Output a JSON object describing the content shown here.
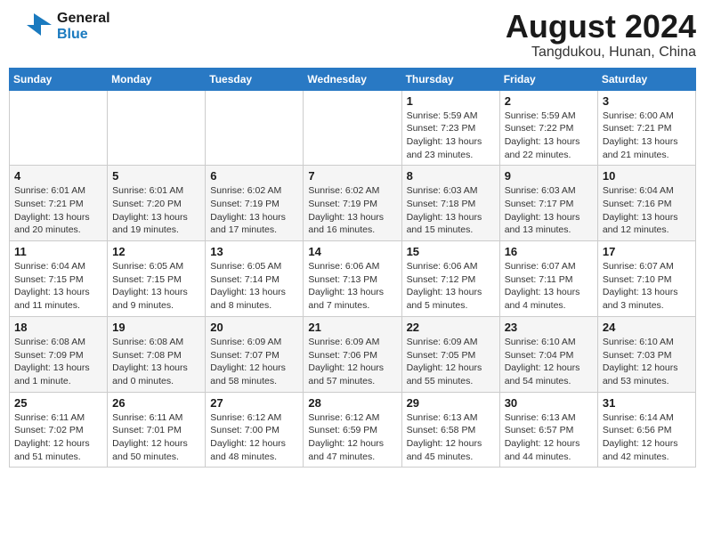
{
  "header": {
    "logo_line1": "General",
    "logo_line2": "Blue",
    "title": "August 2024",
    "subtitle": "Tangdukou, Hunan, China"
  },
  "weekdays": [
    "Sunday",
    "Monday",
    "Tuesday",
    "Wednesday",
    "Thursday",
    "Friday",
    "Saturday"
  ],
  "weeks": [
    [
      {
        "day": "",
        "info": ""
      },
      {
        "day": "",
        "info": ""
      },
      {
        "day": "",
        "info": ""
      },
      {
        "day": "",
        "info": ""
      },
      {
        "day": "1",
        "info": "Sunrise: 5:59 AM\nSunset: 7:23 PM\nDaylight: 13 hours\nand 23 minutes."
      },
      {
        "day": "2",
        "info": "Sunrise: 5:59 AM\nSunset: 7:22 PM\nDaylight: 13 hours\nand 22 minutes."
      },
      {
        "day": "3",
        "info": "Sunrise: 6:00 AM\nSunset: 7:21 PM\nDaylight: 13 hours\nand 21 minutes."
      }
    ],
    [
      {
        "day": "4",
        "info": "Sunrise: 6:01 AM\nSunset: 7:21 PM\nDaylight: 13 hours\nand 20 minutes."
      },
      {
        "day": "5",
        "info": "Sunrise: 6:01 AM\nSunset: 7:20 PM\nDaylight: 13 hours\nand 19 minutes."
      },
      {
        "day": "6",
        "info": "Sunrise: 6:02 AM\nSunset: 7:19 PM\nDaylight: 13 hours\nand 17 minutes."
      },
      {
        "day": "7",
        "info": "Sunrise: 6:02 AM\nSunset: 7:19 PM\nDaylight: 13 hours\nand 16 minutes."
      },
      {
        "day": "8",
        "info": "Sunrise: 6:03 AM\nSunset: 7:18 PM\nDaylight: 13 hours\nand 15 minutes."
      },
      {
        "day": "9",
        "info": "Sunrise: 6:03 AM\nSunset: 7:17 PM\nDaylight: 13 hours\nand 13 minutes."
      },
      {
        "day": "10",
        "info": "Sunrise: 6:04 AM\nSunset: 7:16 PM\nDaylight: 13 hours\nand 12 minutes."
      }
    ],
    [
      {
        "day": "11",
        "info": "Sunrise: 6:04 AM\nSunset: 7:15 PM\nDaylight: 13 hours\nand 11 minutes."
      },
      {
        "day": "12",
        "info": "Sunrise: 6:05 AM\nSunset: 7:15 PM\nDaylight: 13 hours\nand 9 minutes."
      },
      {
        "day": "13",
        "info": "Sunrise: 6:05 AM\nSunset: 7:14 PM\nDaylight: 13 hours\nand 8 minutes."
      },
      {
        "day": "14",
        "info": "Sunrise: 6:06 AM\nSunset: 7:13 PM\nDaylight: 13 hours\nand 7 minutes."
      },
      {
        "day": "15",
        "info": "Sunrise: 6:06 AM\nSunset: 7:12 PM\nDaylight: 13 hours\nand 5 minutes."
      },
      {
        "day": "16",
        "info": "Sunrise: 6:07 AM\nSunset: 7:11 PM\nDaylight: 13 hours\nand 4 minutes."
      },
      {
        "day": "17",
        "info": "Sunrise: 6:07 AM\nSunset: 7:10 PM\nDaylight: 13 hours\nand 3 minutes."
      }
    ],
    [
      {
        "day": "18",
        "info": "Sunrise: 6:08 AM\nSunset: 7:09 PM\nDaylight: 13 hours\nand 1 minute."
      },
      {
        "day": "19",
        "info": "Sunrise: 6:08 AM\nSunset: 7:08 PM\nDaylight: 13 hours\nand 0 minutes."
      },
      {
        "day": "20",
        "info": "Sunrise: 6:09 AM\nSunset: 7:07 PM\nDaylight: 12 hours\nand 58 minutes."
      },
      {
        "day": "21",
        "info": "Sunrise: 6:09 AM\nSunset: 7:06 PM\nDaylight: 12 hours\nand 57 minutes."
      },
      {
        "day": "22",
        "info": "Sunrise: 6:09 AM\nSunset: 7:05 PM\nDaylight: 12 hours\nand 55 minutes."
      },
      {
        "day": "23",
        "info": "Sunrise: 6:10 AM\nSunset: 7:04 PM\nDaylight: 12 hours\nand 54 minutes."
      },
      {
        "day": "24",
        "info": "Sunrise: 6:10 AM\nSunset: 7:03 PM\nDaylight: 12 hours\nand 53 minutes."
      }
    ],
    [
      {
        "day": "25",
        "info": "Sunrise: 6:11 AM\nSunset: 7:02 PM\nDaylight: 12 hours\nand 51 minutes."
      },
      {
        "day": "26",
        "info": "Sunrise: 6:11 AM\nSunset: 7:01 PM\nDaylight: 12 hours\nand 50 minutes."
      },
      {
        "day": "27",
        "info": "Sunrise: 6:12 AM\nSunset: 7:00 PM\nDaylight: 12 hours\nand 48 minutes."
      },
      {
        "day": "28",
        "info": "Sunrise: 6:12 AM\nSunset: 6:59 PM\nDaylight: 12 hours\nand 47 minutes."
      },
      {
        "day": "29",
        "info": "Sunrise: 6:13 AM\nSunset: 6:58 PM\nDaylight: 12 hours\nand 45 minutes."
      },
      {
        "day": "30",
        "info": "Sunrise: 6:13 AM\nSunset: 6:57 PM\nDaylight: 12 hours\nand 44 minutes."
      },
      {
        "day": "31",
        "info": "Sunrise: 6:14 AM\nSunset: 6:56 PM\nDaylight: 12 hours\nand 42 minutes."
      }
    ]
  ]
}
